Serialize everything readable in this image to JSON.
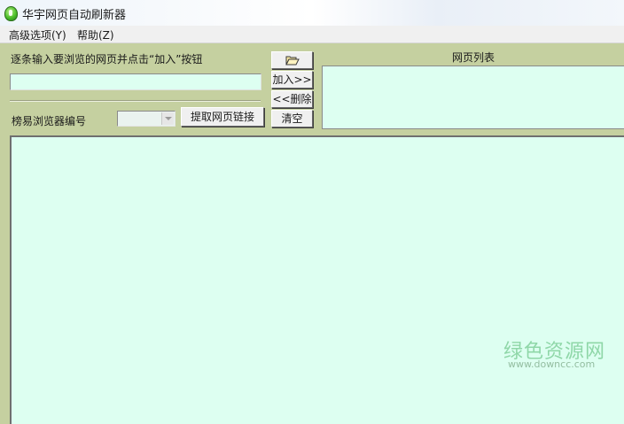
{
  "window": {
    "title": "华宇网页自动刷新器"
  },
  "menu": {
    "items": [
      {
        "label": "高级选项(Y)"
      },
      {
        "label": "帮助(Z)"
      }
    ]
  },
  "input_panel": {
    "instruction": "逐条输入要浏览的网页并点击“加入”按钮",
    "url_input_value": "",
    "browser_label": "榜易浏览器编号",
    "browser_select_value": "",
    "extract_button": "提取网页链接"
  },
  "action_buttons": {
    "open_icon": "folder-open-icon",
    "add": "加入>>",
    "remove": "<<删除",
    "clear": "清空"
  },
  "url_list": {
    "title": "网页列表",
    "items": []
  },
  "watermark": {
    "main": "绿色资源网",
    "sub": "www.downcc.com"
  },
  "colors": {
    "panel_background": "#c5d0a0",
    "field_background": "#ddfff1",
    "watermark": "#8fd7a8"
  }
}
